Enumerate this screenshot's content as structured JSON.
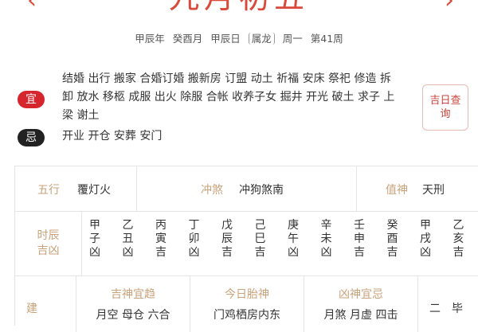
{
  "header": {
    "prev_arrow": "‹",
    "next_arrow": "›",
    "big_date": "九月初五",
    "gz_year": "甲辰年",
    "gz_month": "癸酉月",
    "gz_day": "甲辰日",
    "zodiac": "属龙",
    "weekday": "周一",
    "week_no": "第41周"
  },
  "yi": {
    "badge": "宜",
    "text": "结婚 出行 搬家 合婚订婚 搬新房 订盟 动土 祈福 安床 祭祀 修造 拆卸 放水 移柩 成服 出火 除服 合帐 收养子女 掘井 开光 破土 求子 上梁 谢土"
  },
  "ji": {
    "badge": "忌",
    "text": "开业 开仓 安葬 安门"
  },
  "jiri_button": {
    "line1": "吉日查",
    "line2": "询"
  },
  "info_row": {
    "wuxing_label": "五行",
    "wuxing_value": "覆灯火",
    "chongsha_label": "冲煞",
    "chongsha_value": "冲狗煞南",
    "zhishen_label": "值神",
    "zhishen_value": "天刑"
  },
  "hours": {
    "label_line1": "时辰",
    "label_line2": "吉凶",
    "items": [
      {
        "c1": "甲",
        "c2": "子",
        "luck": "凶"
      },
      {
        "c1": "乙",
        "c2": "丑",
        "luck": "凶"
      },
      {
        "c1": "丙",
        "c2": "寅",
        "luck": "吉"
      },
      {
        "c1": "丁",
        "c2": "卯",
        "luck": "凶"
      },
      {
        "c1": "戊",
        "c2": "辰",
        "luck": "吉"
      },
      {
        "c1": "己",
        "c2": "巳",
        "luck": "吉"
      },
      {
        "c1": "庚",
        "c2": "午",
        "luck": "凶"
      },
      {
        "c1": "辛",
        "c2": "未",
        "luck": "凶"
      },
      {
        "c1": "壬",
        "c2": "申",
        "luck": "吉"
      },
      {
        "c1": "癸",
        "c2": "酉",
        "luck": "吉"
      },
      {
        "c1": "甲",
        "c2": "戌",
        "luck": "凶"
      },
      {
        "c1": "乙",
        "c2": "亥",
        "luck": "吉"
      }
    ]
  },
  "bottom_row": {
    "left_label": "建",
    "jishen_label": "吉神宜趋",
    "jishen_value": "月空 母仓 六合",
    "taishen_label": "今日胎神",
    "taishen_value": "门鸡栖房内东",
    "xiongshen_label": "凶神宜忌",
    "xiongshen_value": "月煞 月虚 四击",
    "right_a": "二",
    "right_b": "毕"
  }
}
